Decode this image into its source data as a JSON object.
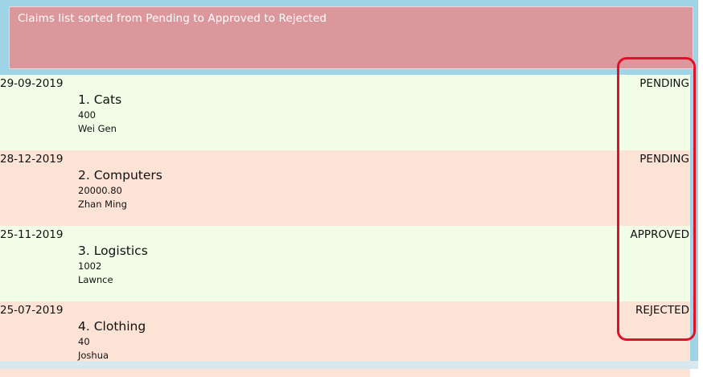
{
  "header": {
    "text": "Claims list sorted from Pending to Approved to Rejected"
  },
  "claims": [
    {
      "date": "29-09-2019",
      "title": "1.  Cats",
      "amount": "400",
      "person": "Wei Gen",
      "status": "PENDING",
      "bg": "#f2fde7"
    },
    {
      "date": "28-12-2019",
      "title": "2.  Computers",
      "amount": "20000.80",
      "person": "Zhan Ming",
      "status": "PENDING",
      "bg": "#fde3d5"
    },
    {
      "date": "25-11-2019",
      "title": "3.  Logistics",
      "amount": "1002",
      "person": "Lawnce",
      "status": "APPROVED",
      "bg": "#f2fde7"
    },
    {
      "date": "25-07-2019",
      "title": "4.  Clothing",
      "amount": "40",
      "person": "Joshua",
      "status": "REJECTED",
      "bg": "#fde3d5"
    }
  ],
  "colors": {
    "header_bg": "#dc979c",
    "frame_bg": "#9fd3e6",
    "highlight": "#e0102a"
  }
}
